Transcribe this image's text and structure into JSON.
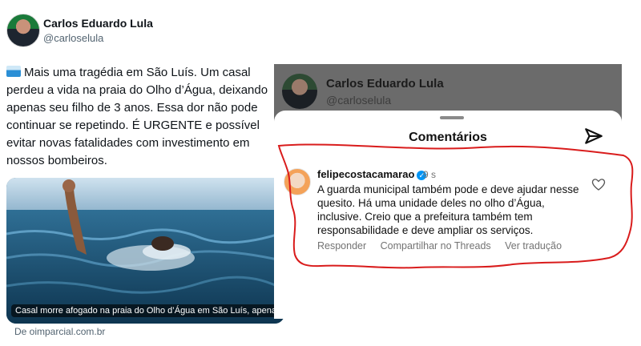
{
  "tweet": {
    "author_name": "Carlos Eduardo Lula",
    "author_handle": "@carloselula",
    "text": "Mais uma tragédia em São Luís. Um casal perdeu a vida na praia do Olho d’Água, deixando apenas seu filho de 3 anos. Essa dor não pode continuar se repetindo. É URGENTE e possível evitar novas fatalidades com investimento em nossos bombeiros.",
    "text_icon": "wave-emoji-icon",
    "card_caption": "Casal morre afogado na praia do Olho d’Água em São Luís, apenas…",
    "card_source": "De oimparcial.com.br"
  },
  "overlay": {
    "bg_name": "Carlos Eduardo Lula",
    "bg_handle": "@carloselula",
    "sheet_title": "Comentários",
    "comment": {
      "user": "felipecostacamarao",
      "time": "9 s",
      "text": "A guarda municipal também pode e deve ajudar nesse quesito. Há uma unidade deles no olho d’Água, inclusive. Creio que a prefeitura também tem responsabilidade e deve ampliar os serviços.",
      "actions": [
        "Responder",
        "Compartilhar no Threads",
        "Ver tradução"
      ]
    }
  },
  "colors": {
    "accent_verified": "#0095f6",
    "highlight_outline": "#d91c1c",
    "secondary_text": "#536471"
  }
}
